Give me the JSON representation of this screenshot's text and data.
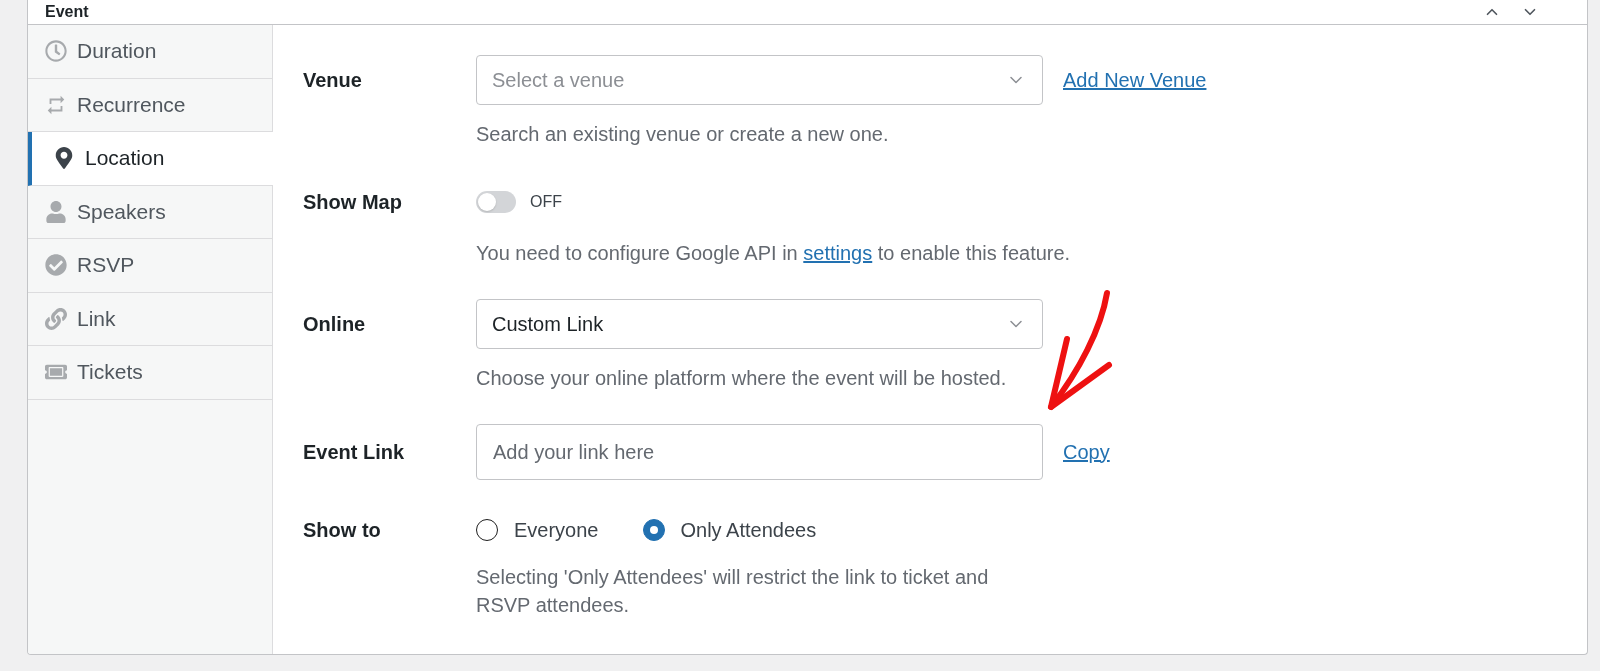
{
  "metabox": {
    "title": "Event"
  },
  "tabs": [
    {
      "label": "Duration",
      "selected": false
    },
    {
      "label": "Recurrence",
      "selected": false
    },
    {
      "label": "Location",
      "selected": true
    },
    {
      "label": "Speakers",
      "selected": false
    },
    {
      "label": "RSVP",
      "selected": false
    },
    {
      "label": "Link",
      "selected": false
    },
    {
      "label": "Tickets",
      "selected": false
    }
  ],
  "fields": [
    {
      "kind": "select",
      "label": "Venue",
      "placeholder": "Select a venue",
      "link": "Add New Venue",
      "description": [
        {
          "kind": "text",
          "text": "Search an existing venue or create a new one."
        }
      ]
    },
    {
      "kind": "toggle",
      "label": "Show Map",
      "on": false,
      "state_label": "OFF",
      "description": [
        {
          "kind": "text",
          "text": "You need to configure Google API in"
        },
        {
          "kind": "link",
          "text": "settings"
        },
        {
          "kind": "text",
          "text": "to enable this feature."
        }
      ]
    },
    {
      "kind": "select",
      "label": "Online",
      "value": "Custom Link",
      "description": [
        {
          "kind": "text",
          "text": "Choose your online platform where the event will be hosted."
        }
      ]
    },
    {
      "kind": "input",
      "label": "Event Link",
      "placeholder": "Add your link here",
      "link": "Copy"
    },
    {
      "kind": "radio",
      "label": "Show to",
      "options": [
        {
          "label": "Everyone",
          "selected": false
        },
        {
          "label": "Only Attendees",
          "selected": true
        }
      ],
      "description": [
        {
          "kind": "text",
          "text": "Selecting 'Only Attendees' will restrict the link to ticket and RSVP attendees."
        }
      ]
    }
  ]
}
